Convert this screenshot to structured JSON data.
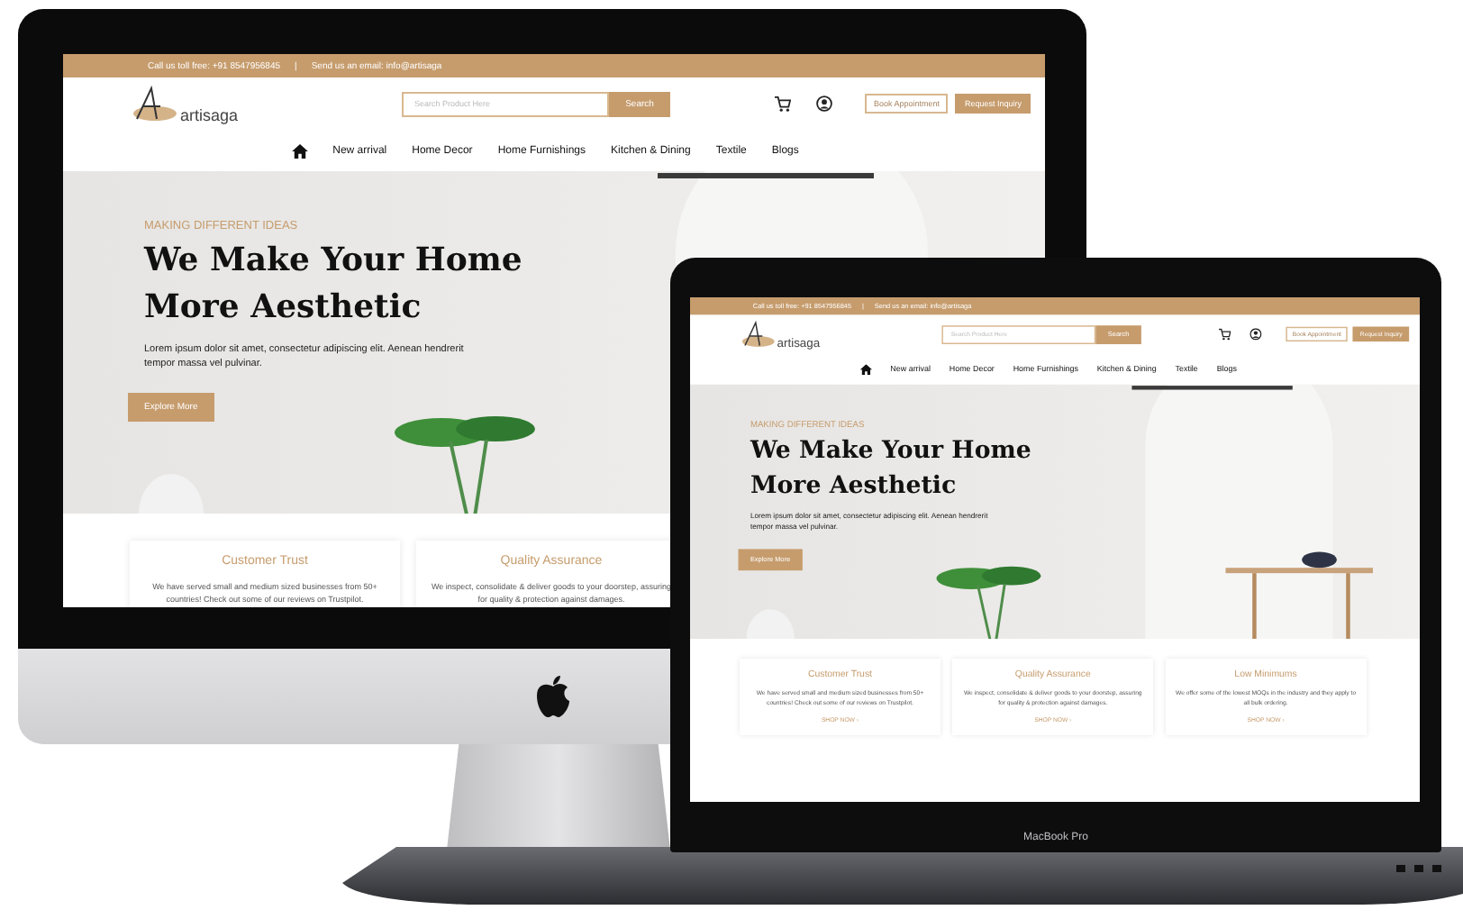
{
  "devices": [
    {
      "kind": "desktop",
      "site": {
        "topbar": {
          "phone": "Call us toll free: +91 8547956845",
          "separator": "|",
          "email": "Send us an email: info@artisaga"
        },
        "logo": "artisaga",
        "search": {
          "placeholder": "Search Product Here",
          "button": "Search"
        },
        "actions": [
          {
            "label": "Book Appointment",
            "kind": "outline"
          },
          {
            "label": "Request Inquiry",
            "kind": "filled"
          }
        ],
        "nav": [
          "New arrival",
          "Home Decor",
          "Home Furnishings",
          "Kitchen & Dining",
          "Textile",
          "Blogs"
        ],
        "hero": {
          "eyebrow": "MAKING DIFFERENT IDEAS",
          "title": [
            "We Make Your Home",
            "More Aesthetic"
          ],
          "text": "Lorem ipsum dolor sit amet, consectetur adipiscing elit. Aenean hendrerit tempor massa vel pulvinar.",
          "button": "Explore More"
        },
        "cards": [
          {
            "title": "Customer Trust",
            "text": "We have served small and medium sized businesses from 50+ countries! Check out some of our reviews on Trustpilot."
          },
          {
            "title": "Quality Assurance",
            "text": "We inspect, consolidate & deliver goods to your doorstep, assuring for quality & protection against damages."
          }
        ]
      }
    },
    {
      "kind": "laptop",
      "label": "MacBook Pro",
      "site": {
        "topbar": {
          "phone": "Call us toll free: +91 8547956845",
          "separator": "|",
          "email": "Send us an email: info@artisaga"
        },
        "logo": "artisaga",
        "search": {
          "placeholder": "Search Product Here",
          "button": "Search"
        },
        "actions": [
          {
            "label": "Book Appointment",
            "kind": "outline"
          },
          {
            "label": "Request Inquiry",
            "kind": "filled"
          }
        ],
        "nav": [
          "New arrival",
          "Home Decor",
          "Home Furnishings",
          "Kitchen & Dining",
          "Textile",
          "Blogs"
        ],
        "hero": {
          "eyebrow": "MAKING DIFFERENT IDEAS",
          "title": [
            "We Make Your Home",
            "More Aesthetic"
          ],
          "text": "Lorem ipsum dolor sit amet, consectetur adipiscing elit. Aenean hendrerit tempor massa vel pulvinar.",
          "button": "Explore More"
        },
        "cards": [
          {
            "title": "Customer Trust",
            "text": "We have served small and medium sized businesses from 50+ countries! Check out some of our reviews on Trustpilot.",
            "link": "SHOP NOW ›"
          },
          {
            "title": "Quality Assurance",
            "text": "We inspect, consolidate & deliver goods to your doorstep, assuring for quality & protection against damages.",
            "link": "SHOP NOW ›"
          },
          {
            "title": "Low Minimums",
            "text": "We offer some of the lowest MOQs in the industry and they apply to all bulk ordering.",
            "link": "SHOP NOW ›"
          }
        ]
      }
    }
  ]
}
